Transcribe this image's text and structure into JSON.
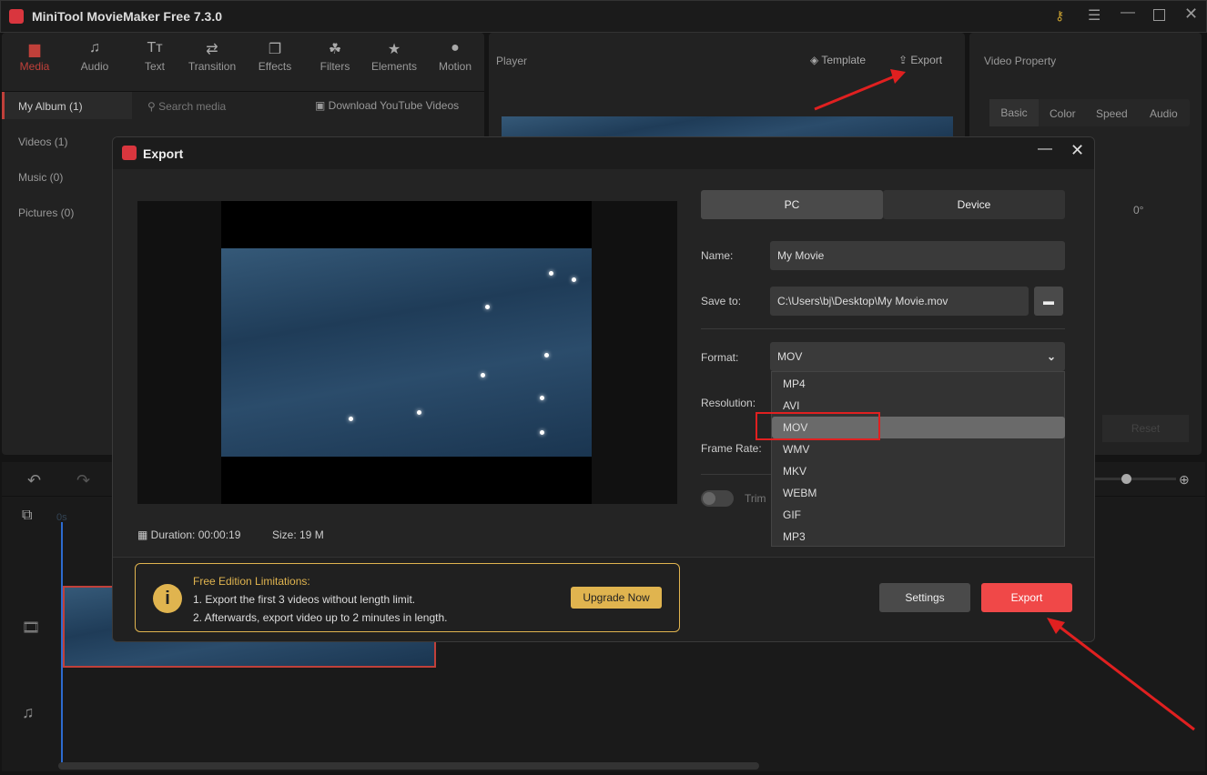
{
  "app": {
    "title": "MiniTool MovieMaker Free 7.3.0"
  },
  "toolbar": [
    {
      "label": "Media",
      "icon": "folder-icon"
    },
    {
      "label": "Audio",
      "icon": "music-icon"
    },
    {
      "label": "Text",
      "icon": "text-icon"
    },
    {
      "label": "Transition",
      "icon": "transition-icon"
    },
    {
      "label": "Effects",
      "icon": "effects-icon"
    },
    {
      "label": "Filters",
      "icon": "filters-icon"
    },
    {
      "label": "Elements",
      "icon": "elements-icon"
    },
    {
      "label": "Motion",
      "icon": "motion-icon"
    }
  ],
  "sidebar": [
    {
      "label": "My Album (1)"
    },
    {
      "label": "Videos (1)"
    },
    {
      "label": "Music (0)"
    },
    {
      "label": "Pictures (0)"
    }
  ],
  "media": {
    "search_placeholder": "Search media",
    "download_label": "Download YouTube Videos"
  },
  "player": {
    "title": "Player",
    "template_label": "Template",
    "export_label": "Export"
  },
  "property": {
    "title": "Video Property",
    "tabs": [
      "Basic",
      "Color",
      "Speed",
      "Audio"
    ],
    "rotation": "0°",
    "reset_label": "Reset"
  },
  "timeline": {
    "time_marker": "0s"
  },
  "dialog": {
    "title": "Export",
    "tabs": [
      "PC",
      "Device"
    ],
    "name_label": "Name:",
    "name_value": "My Movie",
    "save_label": "Save to:",
    "save_value": "C:\\Users\\bj\\Desktop\\My Movie.mov",
    "format_label": "Format:",
    "format_value": "MOV",
    "format_options": [
      "MP4",
      "AVI",
      "MOV",
      "WMV",
      "MKV",
      "WEBM",
      "GIF",
      "MP3"
    ],
    "resolution_label": "Resolution:",
    "framerate_label": "Frame Rate:",
    "trim_label": "Trim",
    "duration": "Duration:  00:00:19",
    "size": "Size:  19 M",
    "limits_title": "Free Edition Limitations:",
    "limits": [
      "1. Export the first 3 videos without length limit.",
      "2. Afterwards, export video up to 2 minutes in length."
    ],
    "upgrade_label": "Upgrade Now",
    "settings_label": "Settings",
    "export_label": "Export"
  },
  "colors": {
    "accent": "#f04848",
    "gold": "#e0b44f",
    "highlight": "#6a6a6a"
  }
}
